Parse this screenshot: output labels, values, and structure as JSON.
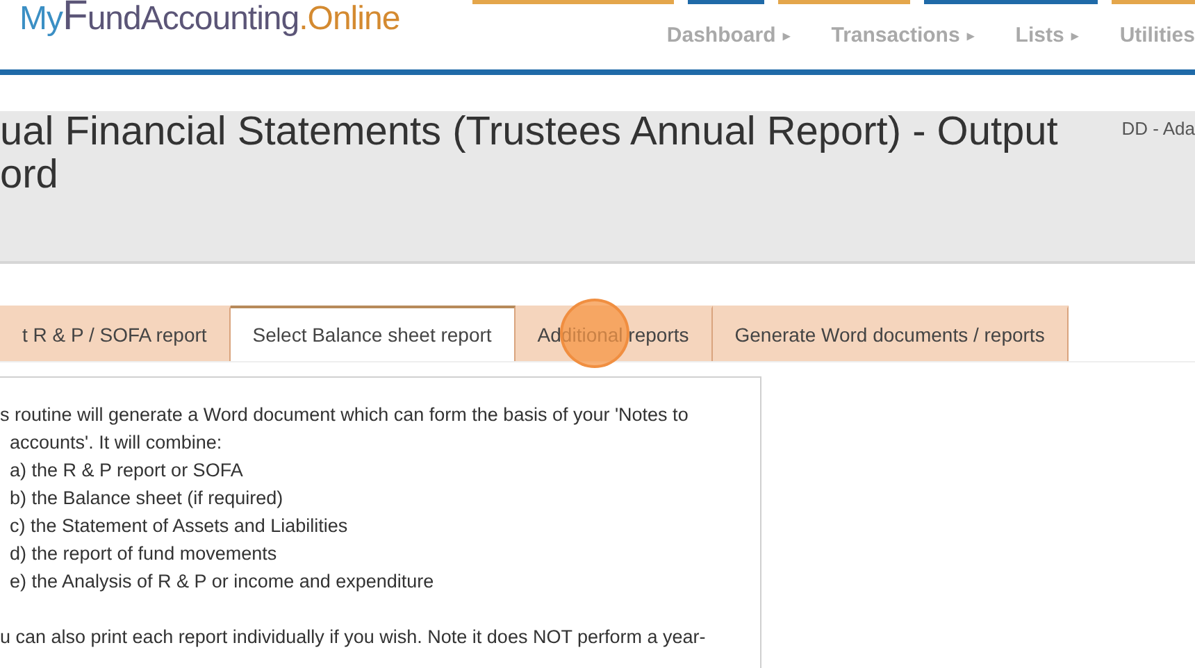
{
  "logo": {
    "parts": [
      "My",
      "F",
      "und",
      "Accounting",
      ".Online"
    ]
  },
  "nav": [
    {
      "label": "Dashboard",
      "caret": "▸"
    },
    {
      "label": "Transactions",
      "caret": "▸"
    },
    {
      "label": "Lists",
      "caret": "▸"
    },
    {
      "label": "Utilities"
    }
  ],
  "title": {
    "lines": [
      "ual Financial Statements (Trustees Annual Report) - Output",
      "ord"
    ],
    "user": "DD - Ada"
  },
  "tabs": [
    {
      "label": "t R & P / SOFA report",
      "selected": false
    },
    {
      "label": "Select Balance sheet report",
      "selected": true
    },
    {
      "label": "Additional reports",
      "selected": false
    },
    {
      "label": "Generate Word documents / reports",
      "selected": false
    }
  ],
  "content": {
    "intro": [
      "s routine will generate a Word document which can form the basis of your 'Notes to",
      "accounts'. It will combine:"
    ],
    "items": [
      "a) the R & P report or SOFA",
      "b) the Balance sheet (if required)",
      "c) the Statement of Assets and Liabilities",
      "d) the report of fund movements",
      "e) the Analysis of R & P or income and expenditure"
    ],
    "note": [
      "u can also print each report individually if you wish. Note it does NOT perform a year-"
    ]
  }
}
